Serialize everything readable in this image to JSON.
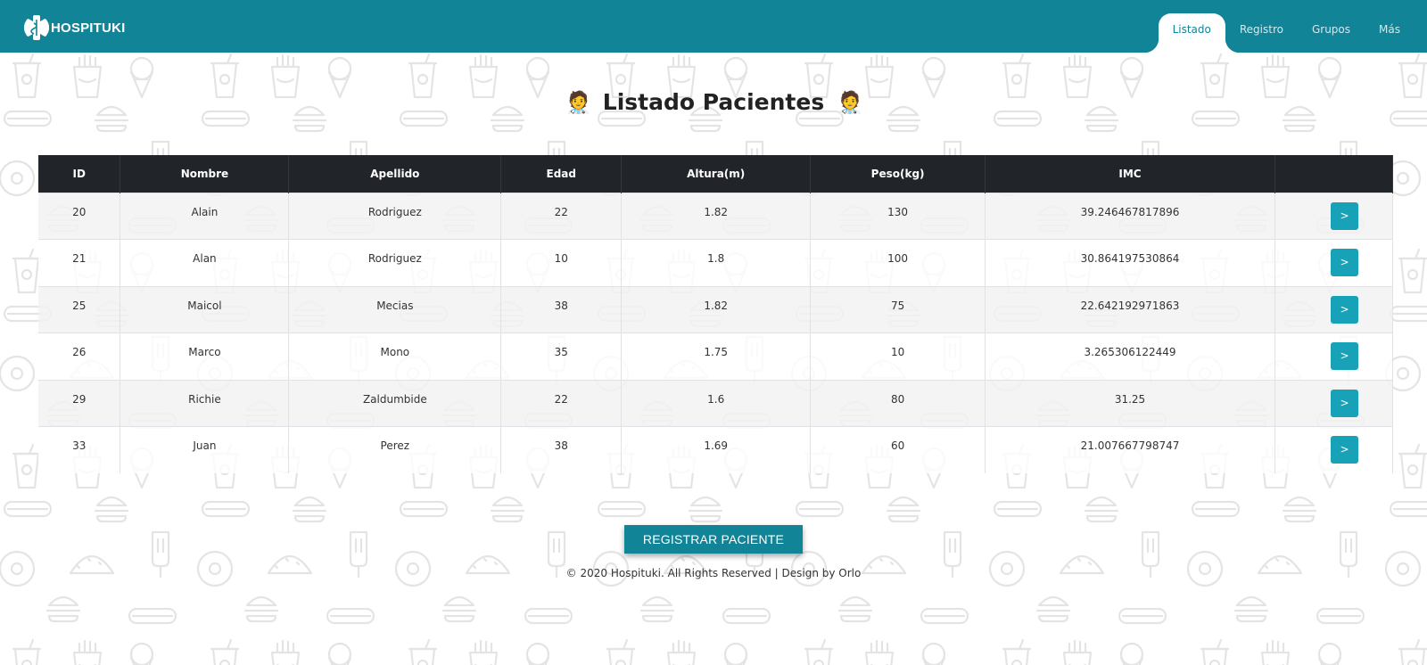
{
  "brand": {
    "name": "HOSPITUKI"
  },
  "nav": {
    "items": [
      {
        "label": "Listado",
        "active": true
      },
      {
        "label": "Registro",
        "active": false
      },
      {
        "label": "Grupos",
        "active": false
      },
      {
        "label": "Más",
        "active": false
      }
    ]
  },
  "page": {
    "title": "Listado Pacientes",
    "title_icon": "🧑‍⚕️"
  },
  "table": {
    "headers": [
      "ID",
      "Nombre",
      "Apellido",
      "Edad",
      "Altura(m)",
      "Peso(kg)",
      "IMC",
      ""
    ],
    "rows": [
      {
        "id": "20",
        "nombre": "Alain",
        "apellido": "Rodriguez",
        "edad": "22",
        "altura": "1.82",
        "peso": "130",
        "imc": "39.246467817896",
        "action": ">"
      },
      {
        "id": "21",
        "nombre": "Alan",
        "apellido": "Rodriguez",
        "edad": "10",
        "altura": "1.8",
        "peso": "100",
        "imc": "30.864197530864",
        "action": ">"
      },
      {
        "id": "25",
        "nombre": "Maicol",
        "apellido": "Mecias",
        "edad": "38",
        "altura": "1.82",
        "peso": "75",
        "imc": "22.642192971863",
        "action": ">"
      },
      {
        "id": "26",
        "nombre": "Marco",
        "apellido": "Mono",
        "edad": "35",
        "altura": "1.75",
        "peso": "10",
        "imc": "3.265306122449",
        "action": ">"
      },
      {
        "id": "29",
        "nombre": "Richie",
        "apellido": "Zaldumbide",
        "edad": "22",
        "altura": "1.6",
        "peso": "80",
        "imc": "31.25",
        "action": ">"
      },
      {
        "id": "33",
        "nombre": "Juan",
        "apellido": "Perez",
        "edad": "38",
        "altura": "1.69",
        "peso": "60",
        "imc": "21.007667798747",
        "action": ">"
      }
    ]
  },
  "actions": {
    "register_label": "REGISTRAR PACIENTE"
  },
  "footer": {
    "text": "© 2020 Hospituki. All Rights Reserved | Design by Orlo"
  },
  "colors": {
    "navbar": "#128497",
    "accent_button": "#17a2b8",
    "table_header": "#212529"
  }
}
